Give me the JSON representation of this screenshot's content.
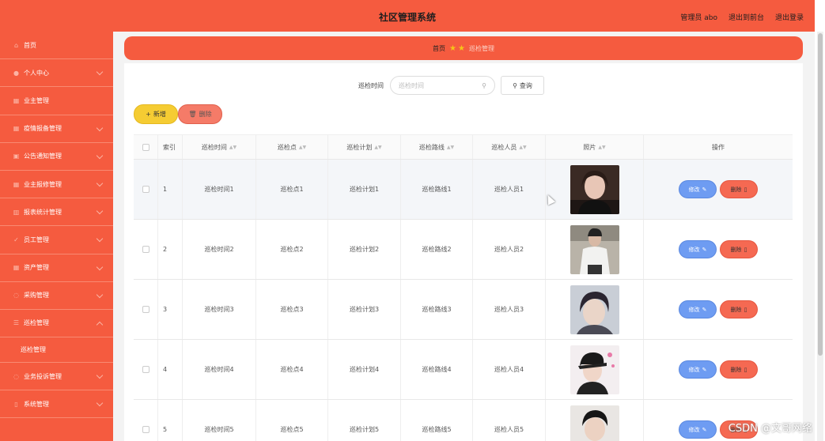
{
  "header": {
    "title": "社区管理系统",
    "admin_label": "管理员 abo",
    "front_label": "退出到前台",
    "logout_label": "退出登录"
  },
  "sidebar": {
    "items": [
      {
        "label": "首页",
        "icon": "home-icon",
        "has_children": false
      },
      {
        "label": "个人中心",
        "icon": "user-icon",
        "has_children": true
      },
      {
        "label": "业主管理",
        "icon": "grid-icon",
        "has_children": false
      },
      {
        "label": "疫情报备管理",
        "icon": "grid-icon",
        "has_children": true
      },
      {
        "label": "公告通知管理",
        "icon": "notice-icon",
        "has_children": true
      },
      {
        "label": "业主报修管理",
        "icon": "grid-icon",
        "has_children": true
      },
      {
        "label": "报表统计管理",
        "icon": "chart-icon",
        "has_children": true
      },
      {
        "label": "员工管理",
        "icon": "staff-icon",
        "has_children": true
      },
      {
        "label": "资产管理",
        "icon": "grid-icon",
        "has_children": true
      },
      {
        "label": "采购管理",
        "icon": "cart-icon",
        "has_children": true
      },
      {
        "label": "巡检管理",
        "icon": "list-icon",
        "has_children": true
      }
    ],
    "sub_item": "巡检管理",
    "items_after": [
      {
        "label": "业务投诉管理",
        "icon": "complaint-icon",
        "has_children": true
      },
      {
        "label": "系统管理",
        "icon": "settings-icon",
        "has_children": true
      }
    ]
  },
  "breadcrumb": {
    "home": "首页",
    "current": "巡检管理"
  },
  "search": {
    "label": "巡检时间",
    "placeholder": "巡检时间",
    "button": "查询"
  },
  "actions": {
    "add": "新增",
    "delete": "删除"
  },
  "table": {
    "columns": [
      "索引",
      "巡检时间",
      "巡检点",
      "巡检计划",
      "巡检路线",
      "巡检人员",
      "照片",
      "操作"
    ],
    "rows": [
      {
        "index": "1",
        "time": "巡检时间1",
        "point": "巡检点1",
        "plan": "巡检计划1",
        "route": "巡检路线1",
        "staff": "巡检人员1"
      },
      {
        "index": "2",
        "time": "巡检时间2",
        "point": "巡检点2",
        "plan": "巡检计划2",
        "route": "巡检路线2",
        "staff": "巡检人员2"
      },
      {
        "index": "3",
        "time": "巡检时间3",
        "point": "巡检点3",
        "plan": "巡检计划3",
        "route": "巡检路线3",
        "staff": "巡检人员3"
      },
      {
        "index": "4",
        "time": "巡检时间4",
        "point": "巡检点4",
        "plan": "巡检计划4",
        "route": "巡检路线4",
        "staff": "巡检人员4"
      },
      {
        "index": "5",
        "time": "巡检时间5",
        "point": "巡检点5",
        "plan": "巡检计划5",
        "route": "巡检路线5",
        "staff": "巡检人员5"
      }
    ],
    "edit_label": "修改",
    "remove_label": "删除"
  },
  "watermark": "CSDN @文哥网络",
  "colors": {
    "primary": "#f55b3f",
    "add_button": "#f5cc33",
    "edit_button": "#6e9cf2",
    "delete_button": "#f56952"
  }
}
